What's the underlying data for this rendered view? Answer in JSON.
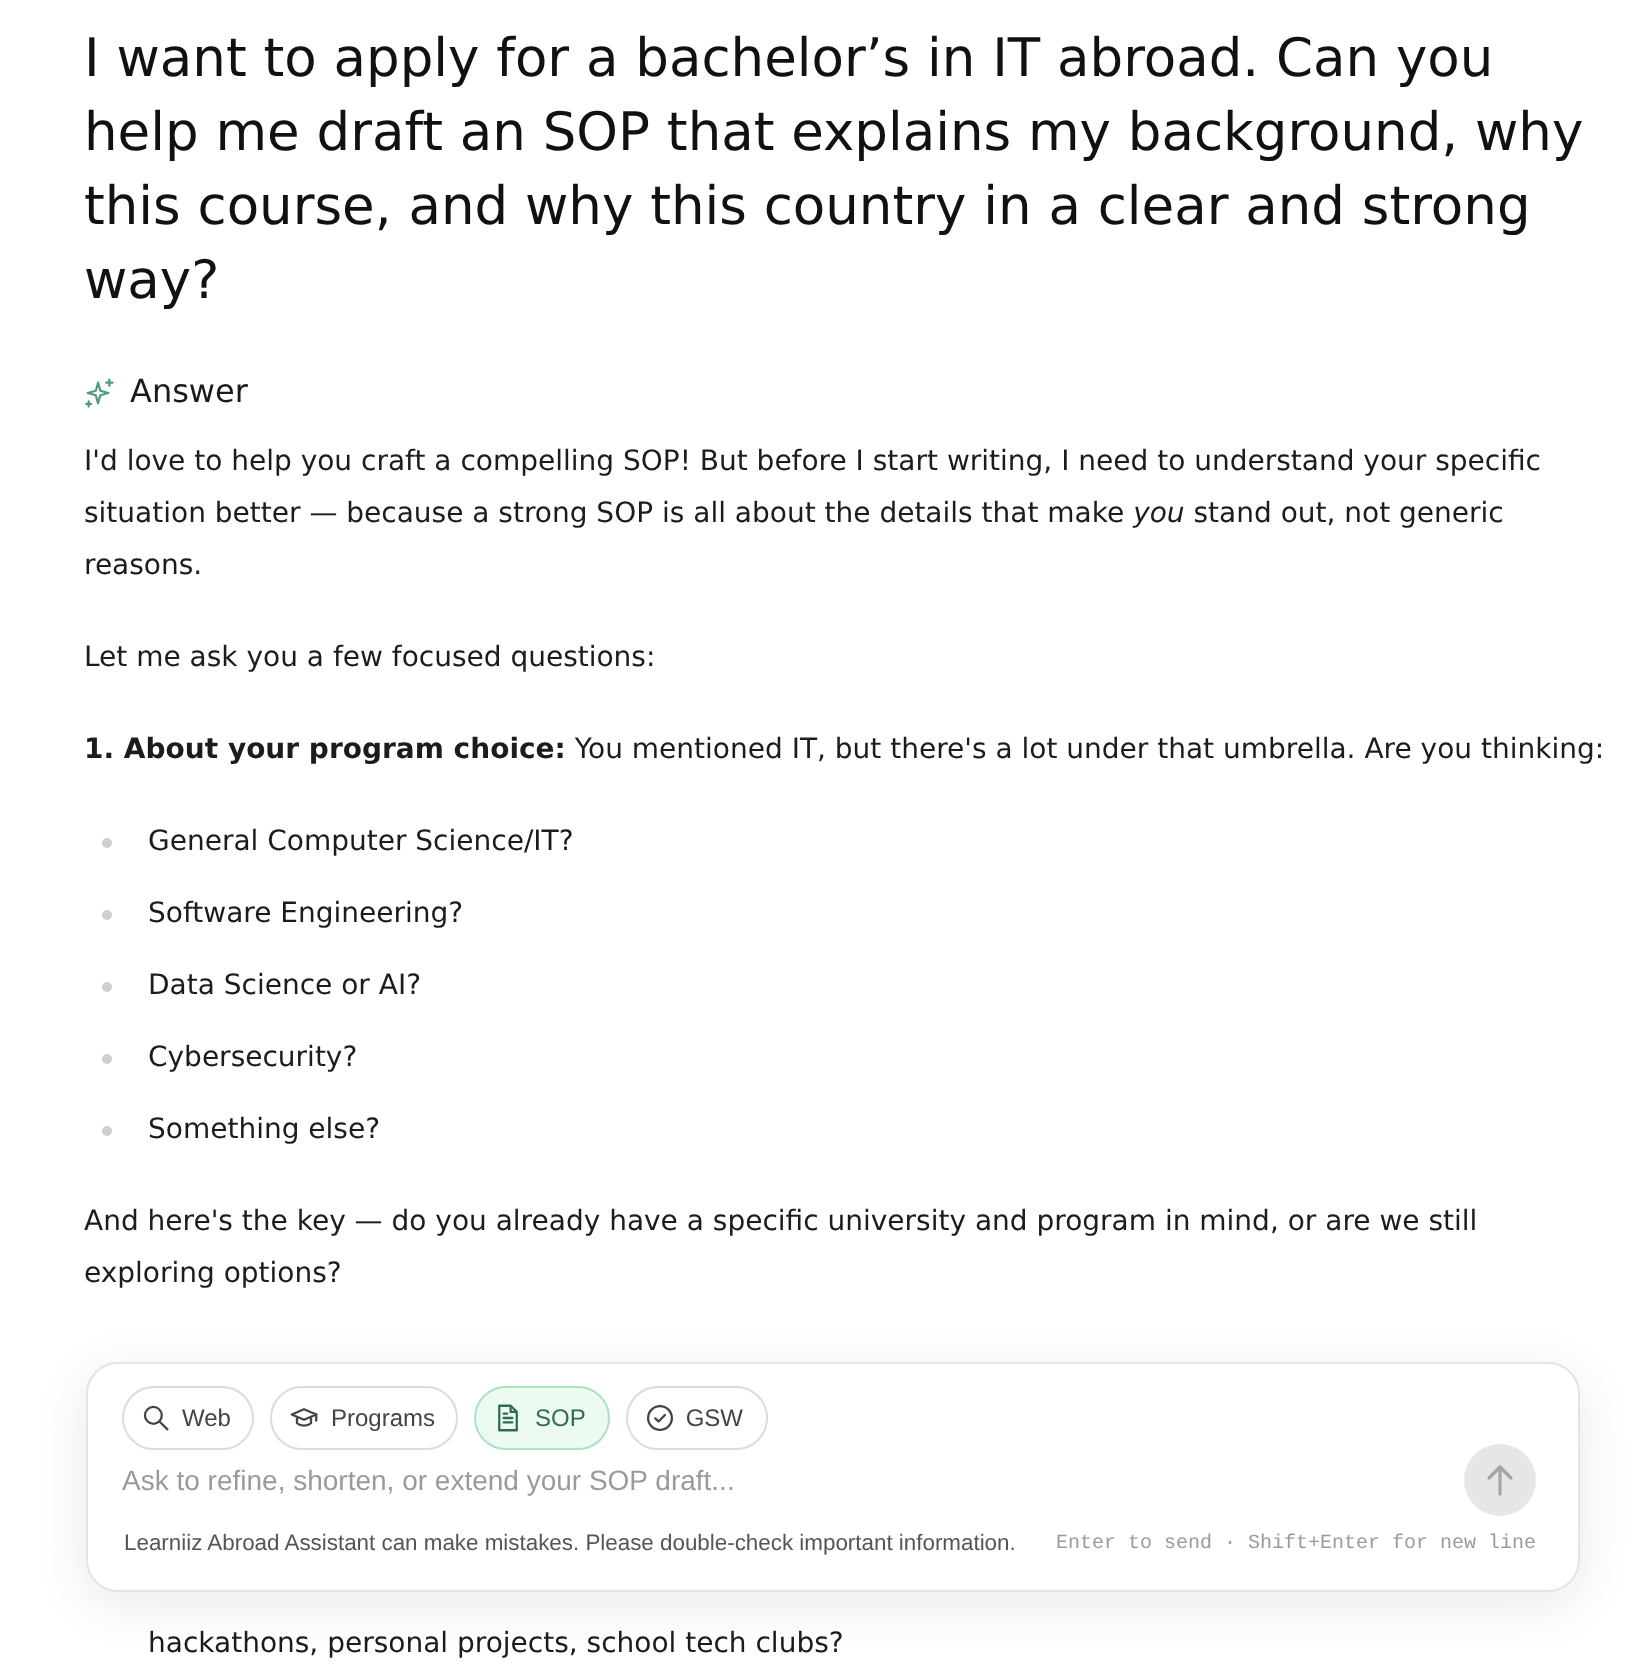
{
  "question": "I want to apply for a bachelor’s in IT abroad. Can you help me draft an SOP that explains my background, why this course, and why this country in a clear and strong way?",
  "answer": {
    "heading": "Answer",
    "blocks": [
      {
        "kind": "paragraph",
        "text": "I'd love to help you craft a compelling SOP! But before I start writing, I need to understand your specific situation better — because a strong SOP is all about the details that make *you* stand out, not generic reasons."
      },
      {
        "kind": "paragraph",
        "text": "Let me ask you a few focused questions:"
      },
      {
        "kind": "paragraph",
        "text": "**1. About your program choice:** You mentioned IT, but there's a lot under that umbrella. Are you thinking:"
      },
      {
        "kind": "list",
        "items": [
          "General Computer Science/IT?",
          "Software Engineering?",
          "Data Science or AI?",
          "Cybersecurity?",
          "Something else?"
        ]
      },
      {
        "kind": "paragraph",
        "text": "And here's the key — do you already have a specific university and program in mind, or are we still exploring options?"
      },
      {
        "kind": "continuation",
        "text": "hackathons, personal projects, school tech clubs?"
      }
    ]
  },
  "composer": {
    "chips": [
      {
        "label": "Web",
        "selected": false
      },
      {
        "label": "Programs",
        "selected": false
      },
      {
        "label": "SOP",
        "selected": true
      },
      {
        "label": "GSW",
        "selected": false
      }
    ],
    "placeholder": "Ask to refine, shorten, or extend your SOP draft...",
    "send_button": {
      "disabled": true
    },
    "disclaimer": "Learniiz Abroad Assistant can make mistakes. Please double-check important information.",
    "hint": "Enter to send · Shift+Enter for new line"
  }
}
